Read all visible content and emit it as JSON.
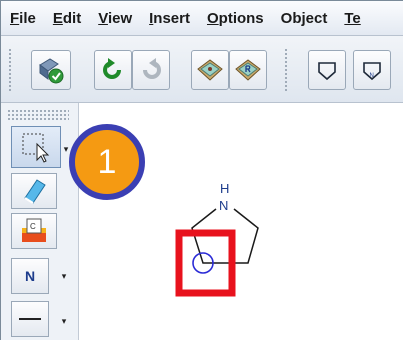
{
  "menubar": {
    "items": [
      {
        "mnemonic": "F",
        "rest": "ile"
      },
      {
        "mnemonic": "E",
        "rest": "dit"
      },
      {
        "mnemonic": "V",
        "rest": "iew"
      },
      {
        "mnemonic": "I",
        "rest": "nsert"
      },
      {
        "mnemonic": "O",
        "rest": "ptions"
      },
      {
        "mnemonic": "",
        "rest": "Object"
      },
      {
        "mnemonic": "Te",
        "rest": ""
      }
    ]
  },
  "palette": {
    "atom_button_label": "N"
  },
  "canvas": {
    "molecule_atom_h": "H",
    "molecule_atom_n": "N"
  },
  "step_badge": {
    "number": "1"
  },
  "colors": {
    "highlight_box": "#e8121d",
    "badge_fill": "#f59a12",
    "badge_border": "#3b3fb3",
    "cursor_circle": "#2b2bd6"
  }
}
